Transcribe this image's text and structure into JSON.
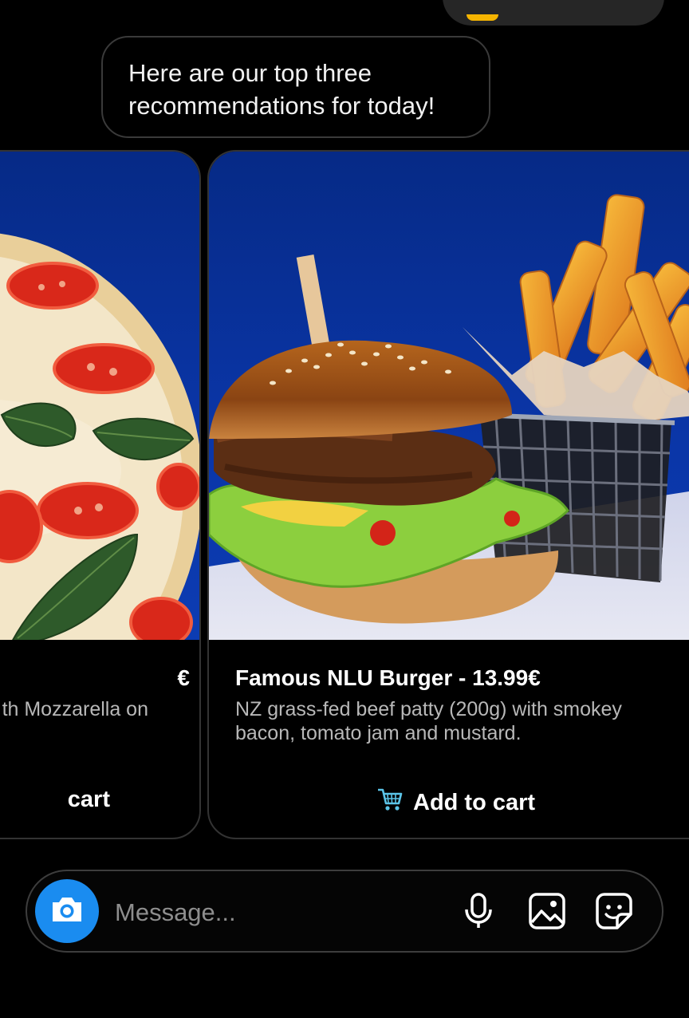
{
  "conversation": {
    "bot_message": "Here are our top three recommendations for today!"
  },
  "cards": [
    {
      "title": "€",
      "description": "th Mozzarella on",
      "cart_label": "cart",
      "image": "pizza-margherita"
    },
    {
      "title": "Famous NLU Burger - 13.99€",
      "description": "NZ grass-fed beef patty (200g) with smokey bacon, tomato jam and mustard.",
      "cart_label": "Add to cart",
      "cart_icon": "shopping-cart-icon",
      "image": "burger-and-fries"
    }
  ],
  "composer": {
    "placeholder": "Message...",
    "icons": [
      "camera-icon",
      "microphone-icon",
      "gallery-icon",
      "sticker-icon"
    ]
  },
  "colors": {
    "background": "#000000",
    "accent_blue": "#1a8cf0",
    "card_border": "#333333",
    "image_backdrop": "#0a35a6",
    "description_gray": "#b8b8b8"
  }
}
